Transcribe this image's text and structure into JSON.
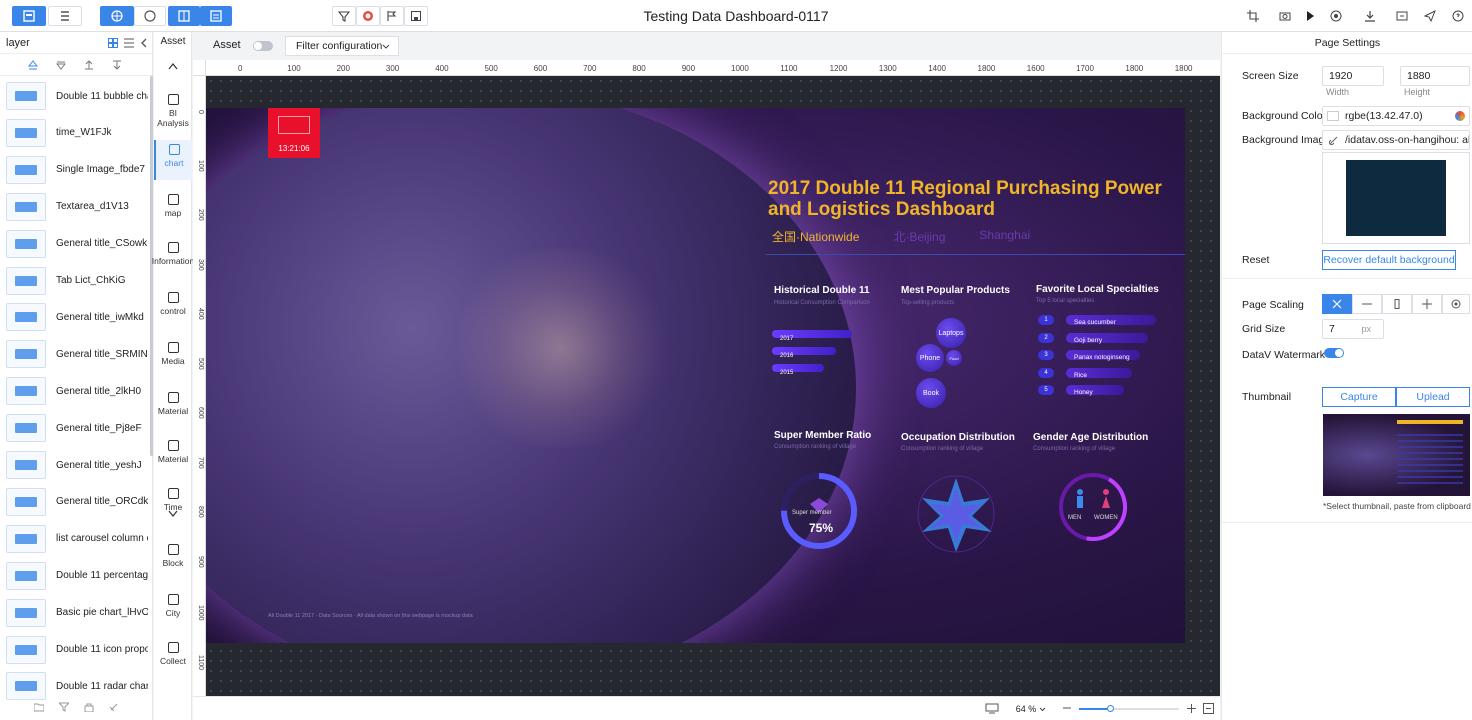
{
  "app": {
    "title": "Testing Data Dashboard-0117"
  },
  "layer_panel": {
    "title": "layer",
    "items": [
      {
        "label": "Double 11 bubble chart",
        "icon": "bubble-chart-icon"
      },
      {
        "label": "time_W1FJk",
        "icon": "time-icon"
      },
      {
        "label": "Single Image_fbde7",
        "icon": "image-icon"
      },
      {
        "label": "Textarea_d1V13",
        "icon": "textarea-icon"
      },
      {
        "label": "General title_CSowk",
        "icon": "title-icon"
      },
      {
        "label": "Tab Lict_ChKiG",
        "icon": "tab-list-icon"
      },
      {
        "label": "General title_iwMkd",
        "icon": "title-icon"
      },
      {
        "label": "General title_SRMIN",
        "icon": "title-icon"
      },
      {
        "label": "General title_2lkH0",
        "icon": "title-icon"
      },
      {
        "label": "General title_Pj8eF",
        "icon": "title-icon"
      },
      {
        "label": "General title_yeshJ",
        "icon": "title-icon"
      },
      {
        "label": "General title_ORCdk",
        "icon": "title-icon"
      },
      {
        "label": "list carousel column ch...",
        "icon": "list-carousel-icon"
      },
      {
        "label": "Double 11 percentage ...",
        "icon": "percentage-icon"
      },
      {
        "label": "Basic pie chart_lHvO6",
        "icon": "pie-chart-icon"
      },
      {
        "label": "Double 11 icon proport...",
        "icon": "icon-proportion-icon"
      },
      {
        "label": "Double 11 radar chart_...",
        "icon": "radar-chart-icon"
      }
    ]
  },
  "asset_panel": {
    "title": "Asset",
    "items": [
      {
        "label": "BI Analysis",
        "icon": "bi-icon"
      },
      {
        "label": "chart",
        "icon": "chart-icon",
        "active": true
      },
      {
        "label": "map",
        "icon": "map-icon"
      },
      {
        "label": "Information",
        "icon": "information-icon"
      },
      {
        "label": "control",
        "icon": "control-icon"
      },
      {
        "label": "Media",
        "icon": "media-icon"
      },
      {
        "label": "Material",
        "icon": "material-icon"
      },
      {
        "label": "Material",
        "icon": "material2-icon"
      },
      {
        "label": "Time",
        "icon": "time-icon"
      },
      {
        "label": "Block",
        "icon": "block-icon"
      },
      {
        "label": "City",
        "icon": "city-icon"
      },
      {
        "label": "Collect",
        "icon": "collect-icon"
      }
    ]
  },
  "canvas_bar": {
    "asset_label": "Asset",
    "filter_label": "Filter configuration"
  },
  "ruler": {
    "top": [
      "0",
      "100",
      "200",
      "300",
      "400",
      "500",
      "600",
      "700",
      "800",
      "900",
      "1000",
      "1100",
      "1200",
      "1300",
      "1400",
      "1800",
      "1600",
      "1700",
      "1800",
      "1800"
    ],
    "left": [
      "0",
      "100",
      "200",
      "300",
      "400",
      "500",
      "600",
      "700",
      "800",
      "900",
      "1000",
      "1100"
    ]
  },
  "dashboard": {
    "badge": "13:21:06",
    "title_line1": "2017 Double 11 Regional Purchasing Power",
    "title_line2": "and Logistics Dashboard",
    "tabs": [
      "全国·Nationwide",
      "北·Beijing",
      "Shanghai"
    ],
    "historical": {
      "title": "Historical Double 11",
      "sub": "Historical Consumption Comparison",
      "years": [
        "2017",
        "2016",
        "2015"
      ]
    },
    "products": {
      "title": "Mest Popular Products",
      "sub": "Top-selling products",
      "bubbles": [
        "Laptops",
        "Phone",
        "Food",
        "Book"
      ]
    },
    "specialties": {
      "title": "Favorite Local Specialties",
      "sub": "Top 5 local specialties",
      "items": [
        {
          "rank": "1",
          "name": "Sea cucumber"
        },
        {
          "rank": "2",
          "name": "Goji berry"
        },
        {
          "rank": "3",
          "name": "Panax notoginseng"
        },
        {
          "rank": "4",
          "name": "Rice"
        },
        {
          "rank": "5",
          "name": "Honey"
        }
      ]
    },
    "member": {
      "title": "Super Member Ratio",
      "sub": "Consumption ranking of village",
      "inner_label": "Super member",
      "value": "75%"
    },
    "occupation": {
      "title": "Occupation Distribution",
      "sub": "Consumption ranking of village"
    },
    "gender": {
      "title": "Gender Age Distribution",
      "sub": "Consumption ranking of village",
      "left": "MEN",
      "right": "WOMEN"
    },
    "footnote": "Ali Double 11 2017 · Data Sources · All data shown on this webpage is mockup data"
  },
  "bottom_bar": {
    "zoom": "64 %"
  },
  "settings": {
    "title": "Page Settings",
    "screen_size_label": "Screen Size",
    "width_value": "1920",
    "height_value": "1880",
    "width_caption": "Width",
    "height_caption": "Height",
    "bg_color_label": "Background Color",
    "bg_color_value": "rgbe(13.42.47.0)",
    "bg_image_label": "Background Image",
    "bg_image_value": "/idatav.oss-on-hangihou: allyr",
    "reset_label": "Reset",
    "reset_button": "Recover default background",
    "page_scaling_label": "Page Scaling",
    "grid_size_label": "Grid Size",
    "grid_size_value": "7",
    "grid_unit": "px",
    "watermark_label": "DataV Watermark",
    "thumbnail_label": "Thumbnail",
    "capture_button": "Capture",
    "upload_button": "Uplead",
    "thumbnail_note": "*Select thumbnail, paste from clipboard",
    "accent": "#3a86e8",
    "bg_preview_color": "#0d2a3f"
  }
}
